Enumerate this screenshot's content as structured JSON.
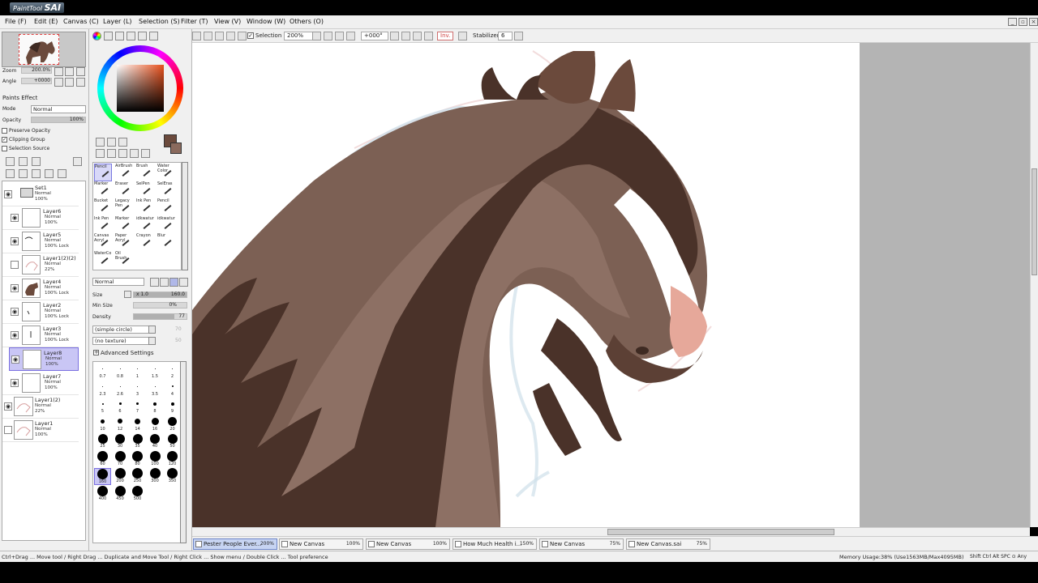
{
  "app": {
    "logo_small": "PaintTool",
    "logo_big": "SAI"
  },
  "menu": [
    "File (F)",
    "Edit (E)",
    "Canvas (C)",
    "Layer (L)",
    "Selection (S)",
    "Filter (T)",
    "View (V)",
    "Window (W)",
    "Others (O)"
  ],
  "toolbar": {
    "selection_label": "Selection",
    "zoom": "200%",
    "rotation": "+000°",
    "invert_label": "Inv.",
    "stabilizer_label": "Stabilizer",
    "stabilizer_value": "6"
  },
  "navigator": {
    "zoom_label": "Zoom",
    "zoom_value": "200.0%",
    "angle_label": "Angle",
    "angle_value": "+0000"
  },
  "layer_props": {
    "section": "Paints Effect",
    "mode_label": "Mode",
    "mode_value": "Normal",
    "opacity_label": "Opacity",
    "opacity_value": "100%",
    "preserve_opacity": "Preserve Opacity",
    "clipping_group": "Clipping Group",
    "selection_source": "Selection Source"
  },
  "layers": [
    {
      "name": "Set1",
      "mode": "Normal",
      "opacity": "100%",
      "kind": "folder"
    },
    {
      "name": "Layer6",
      "mode": "Normal",
      "opacity": "100%"
    },
    {
      "name": "Layer5",
      "mode": "Normal",
      "opacity": "100% Lock"
    },
    {
      "name": "Layer1(2)(2)",
      "mode": "Normal",
      "opacity": "22%"
    },
    {
      "name": "Layer4",
      "mode": "Normal",
      "opacity": "100% Lock"
    },
    {
      "name": "Layer2",
      "mode": "Normal",
      "opacity": "100% Lock"
    },
    {
      "name": "Layer3",
      "mode": "Normal",
      "opacity": "100% Lock"
    },
    {
      "name": "Layer8",
      "mode": "Normal",
      "opacity": "100%",
      "selected": true
    },
    {
      "name": "Layer7",
      "mode": "Normal",
      "opacity": "100%"
    },
    {
      "name": "Layer1(2)",
      "mode": "Normal",
      "opacity": "22%"
    },
    {
      "name": "Layer1",
      "mode": "Normal",
      "opacity": "100%"
    }
  ],
  "tools": [
    {
      "label": "Pencil"
    },
    {
      "label": "AirBrush"
    },
    {
      "label": "Brush"
    },
    {
      "label": "Water Color"
    },
    {
      "label": "Marker"
    },
    {
      "label": "Eraser"
    },
    {
      "label": "SelPen"
    },
    {
      "label": "SelEras"
    },
    {
      "label": "Bucket"
    },
    {
      "label": "Legacy Pen"
    },
    {
      "label": "Ink Pen"
    },
    {
      "label": "Pencil"
    },
    {
      "label": "Ink Pen"
    },
    {
      "label": "Marker"
    },
    {
      "label": "idkwatur"
    },
    {
      "label": "idkwatur"
    },
    {
      "label": "Canvas Acryl"
    },
    {
      "label": "Paper Acryl"
    },
    {
      "label": "Crayon"
    },
    {
      "label": "Blur"
    },
    {
      "label": "WaterCo"
    },
    {
      "label": "Oil Brush"
    }
  ],
  "brush": {
    "mode": "Normal",
    "size_label": "Size",
    "size_mult": "x 1.0",
    "size_value": "160.0",
    "min_size_label": "Min Size",
    "min_size_value": "0%",
    "density_label": "Density",
    "density_value": "77",
    "shape": "(simple circle)",
    "shape_value": "70",
    "texture": "(no texture)",
    "texture_value": "50",
    "advanced": "Advanced Settings"
  },
  "brush_sizes": [
    {
      "label": "0.7",
      "d": 1
    },
    {
      "label": "0.8",
      "d": 1
    },
    {
      "label": "1",
      "d": 1
    },
    {
      "label": "1.5",
      "d": 1
    },
    {
      "label": "2",
      "d": 1
    },
    {
      "label": "2.3",
      "d": 1
    },
    {
      "label": "2.6",
      "d": 1
    },
    {
      "label": "3",
      "d": 1
    },
    {
      "label": "3.5",
      "d": 1
    },
    {
      "label": "4",
      "d": 2
    },
    {
      "label": "5",
      "d": 2
    },
    {
      "label": "6",
      "d": 3
    },
    {
      "label": "7",
      "d": 3
    },
    {
      "label": "8",
      "d": 4
    },
    {
      "label": "9",
      "d": 4
    },
    {
      "label": "10",
      "d": 5
    },
    {
      "label": "12",
      "d": 6
    },
    {
      "label": "14",
      "d": 7
    },
    {
      "label": "16",
      "d": 9
    },
    {
      "label": "20",
      "d": 11
    },
    {
      "label": "25",
      "d": 12
    },
    {
      "label": "30",
      "d": 12
    },
    {
      "label": "35",
      "d": 12
    },
    {
      "label": "40",
      "d": 12
    },
    {
      "label": "50",
      "d": 12
    },
    {
      "label": "60",
      "d": 13
    },
    {
      "label": "70",
      "d": 13
    },
    {
      "label": "80",
      "d": 13
    },
    {
      "label": "100",
      "d": 13
    },
    {
      "label": "120",
      "d": 13
    },
    {
      "label": "160",
      "d": 13
    },
    {
      "label": "200",
      "d": 13
    },
    {
      "label": "250",
      "d": 13
    },
    {
      "label": "300",
      "d": 13
    },
    {
      "label": "350",
      "d": 13
    },
    {
      "label": "400",
      "d": 13
    },
    {
      "label": "450",
      "d": 13
    },
    {
      "label": "500",
      "d": 13
    }
  ],
  "tabs": [
    {
      "name": "Pester People Ever...",
      "zoom": "200%",
      "active": true
    },
    {
      "name": "New Canvas",
      "zoom": "100%"
    },
    {
      "name": "New Canvas",
      "zoom": "100%"
    },
    {
      "name": "How Much Health i...",
      "zoom": "150%"
    },
    {
      "name": "New Canvas",
      "zoom": "75%"
    },
    {
      "name": "New Canvas.sai",
      "zoom": "75%"
    }
  ],
  "status": {
    "hint": "Ctrl+Drag ... Move tool / Right Drag ... Duplicate and Move Tool / Right Click ... Show menu / Double Click ... Tool preference",
    "memory": "Memory Usage:38% (Use1563MB/Max4095MB)",
    "keys": "Shift Ctrl Alt SPC ⊙ Any"
  },
  "colors": {
    "main_color": "#6b4a3c",
    "sub_color": "#8a6a5d",
    "selected_layer": "#c9c6f5",
    "active_tab": "#c7d4f2"
  }
}
